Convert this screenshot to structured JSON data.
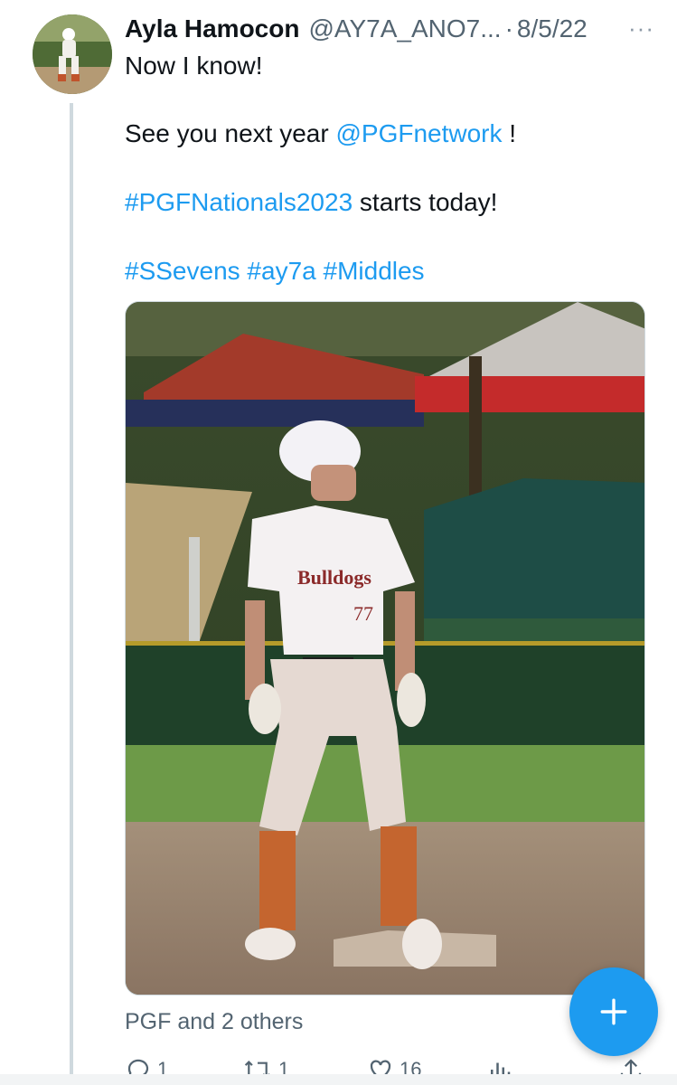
{
  "tweet": {
    "author_name": "Ayla Hamocon",
    "handle": "@AY7A_ANO7...",
    "separator": "·",
    "date": "8/5/22",
    "more": "···",
    "line1": "Now I know!",
    "line2_prefix": "See you next year ",
    "mention": "@PGFnetwork",
    "line2_suffix": " !",
    "hashtag_nationals": "#PGFNationals2023",
    "line3_suffix": " starts today!",
    "hashtags": [
      "#SSevens",
      "#ay7a",
      "#Middles"
    ],
    "social_context": "PGF and 2 others"
  },
  "actions": {
    "replies": "1",
    "retweets": "1",
    "likes": "16"
  },
  "icons": {
    "reply": "reply-icon",
    "retweet": "retweet-icon",
    "like": "heart-icon",
    "views": "analytics-icon",
    "share": "share-icon",
    "compose": "plus-icon"
  },
  "colors": {
    "link": "#1d9bf0",
    "fab": "#1d9bf0",
    "muted": "#536471"
  }
}
